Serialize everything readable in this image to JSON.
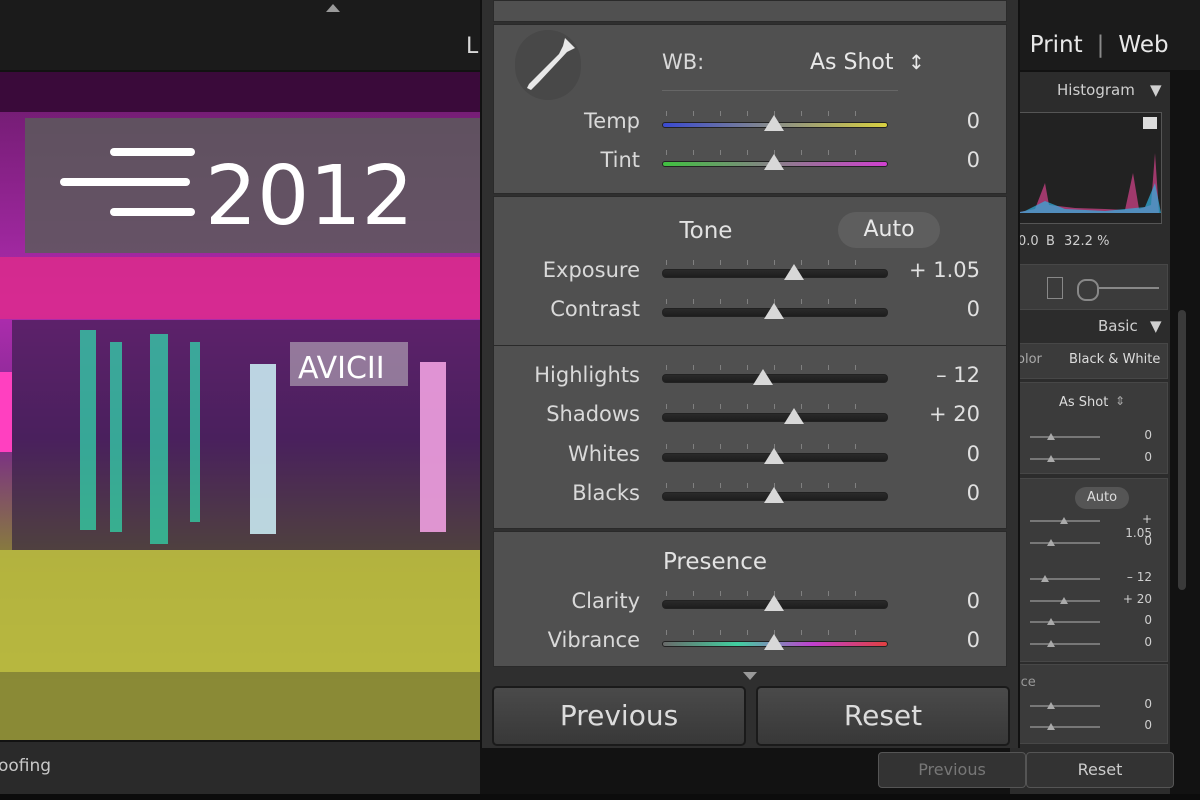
{
  "top_nav": {
    "partial_module": "L",
    "print": "Print",
    "web": "Web",
    "sep": "|"
  },
  "photo": {
    "sign_year": "2012",
    "sign_name": "AVICII"
  },
  "left_bottom": {
    "label": "oofing"
  },
  "right_panel": {
    "histogram_title": "Histogram",
    "hist_readout_a": "0.0",
    "hist_readout_b_label": "B",
    "hist_readout_b": "32.2 %",
    "basic_title": "Basic",
    "tab_color": "olor",
    "tab_bw": "Black & White",
    "wb_value": "As Shot",
    "auto": "Auto",
    "values": [
      "0",
      "0",
      "+ 1.05",
      "0",
      "– 12",
      "+ 20",
      "0",
      "0",
      "0",
      "0"
    ],
    "presence_partial": "ice",
    "previous": "Previous",
    "reset": "Reset"
  },
  "wb": {
    "label": "WB:",
    "value": "As Shot",
    "dropdown_glyph": "↕"
  },
  "sliders_wb": [
    {
      "label": "Temp",
      "value": "0",
      "pos": 0.5
    },
    {
      "label": "Tint",
      "value": "0",
      "pos": 0.5
    }
  ],
  "tone": {
    "heading": "Tone",
    "auto": "Auto"
  },
  "sliders_tone": [
    {
      "label": "Exposure",
      "value": "+ 1.05",
      "pos": 0.59
    },
    {
      "label": "Contrast",
      "value": "0",
      "pos": 0.5
    }
  ],
  "sliders_tone2": [
    {
      "label": "Highlights",
      "value": "– 12",
      "pos": 0.45
    },
    {
      "label": "Shadows",
      "value": "+ 20",
      "pos": 0.59
    },
    {
      "label": "Whites",
      "value": "0",
      "pos": 0.5
    },
    {
      "label": "Blacks",
      "value": "0",
      "pos": 0.5
    }
  ],
  "presence": {
    "heading": "Presence"
  },
  "sliders_presence": [
    {
      "label": "Clarity",
      "value": "0",
      "pos": 0.5
    },
    {
      "label": "Vibrance",
      "value": "0",
      "pos": 0.5
    }
  ],
  "buttons": {
    "previous": "Previous",
    "reset": "Reset"
  },
  "colors": {
    "panel_bg": "#505050",
    "knob": "#d8d8d8",
    "accent_magenta": "#e040e0"
  }
}
